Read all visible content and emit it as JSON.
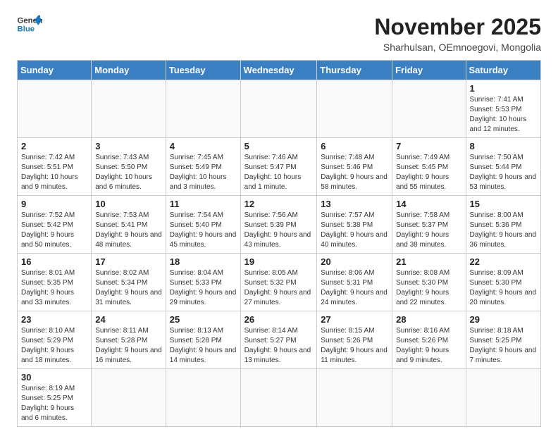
{
  "logo": {
    "text_general": "General",
    "text_blue": "Blue"
  },
  "title": "November 2025",
  "subtitle": "Sharhulsan, OEmnoegovi, Mongolia",
  "days_of_week": [
    "Sunday",
    "Monday",
    "Tuesday",
    "Wednesday",
    "Thursday",
    "Friday",
    "Saturday"
  ],
  "weeks": [
    [
      {
        "day": "",
        "info": ""
      },
      {
        "day": "",
        "info": ""
      },
      {
        "day": "",
        "info": ""
      },
      {
        "day": "",
        "info": ""
      },
      {
        "day": "",
        "info": ""
      },
      {
        "day": "",
        "info": ""
      },
      {
        "day": "1",
        "info": "Sunrise: 7:41 AM\nSunset: 5:53 PM\nDaylight: 10 hours and 12 minutes."
      }
    ],
    [
      {
        "day": "2",
        "info": "Sunrise: 7:42 AM\nSunset: 5:51 PM\nDaylight: 10 hours and 9 minutes."
      },
      {
        "day": "3",
        "info": "Sunrise: 7:43 AM\nSunset: 5:50 PM\nDaylight: 10 hours and 6 minutes."
      },
      {
        "day": "4",
        "info": "Sunrise: 7:45 AM\nSunset: 5:49 PM\nDaylight: 10 hours and 3 minutes."
      },
      {
        "day": "5",
        "info": "Sunrise: 7:46 AM\nSunset: 5:47 PM\nDaylight: 10 hours and 1 minute."
      },
      {
        "day": "6",
        "info": "Sunrise: 7:48 AM\nSunset: 5:46 PM\nDaylight: 9 hours and 58 minutes."
      },
      {
        "day": "7",
        "info": "Sunrise: 7:49 AM\nSunset: 5:45 PM\nDaylight: 9 hours and 55 minutes."
      },
      {
        "day": "8",
        "info": "Sunrise: 7:50 AM\nSunset: 5:44 PM\nDaylight: 9 hours and 53 minutes."
      }
    ],
    [
      {
        "day": "9",
        "info": "Sunrise: 7:52 AM\nSunset: 5:42 PM\nDaylight: 9 hours and 50 minutes."
      },
      {
        "day": "10",
        "info": "Sunrise: 7:53 AM\nSunset: 5:41 PM\nDaylight: 9 hours and 48 minutes."
      },
      {
        "day": "11",
        "info": "Sunrise: 7:54 AM\nSunset: 5:40 PM\nDaylight: 9 hours and 45 minutes."
      },
      {
        "day": "12",
        "info": "Sunrise: 7:56 AM\nSunset: 5:39 PM\nDaylight: 9 hours and 43 minutes."
      },
      {
        "day": "13",
        "info": "Sunrise: 7:57 AM\nSunset: 5:38 PM\nDaylight: 9 hours and 40 minutes."
      },
      {
        "day": "14",
        "info": "Sunrise: 7:58 AM\nSunset: 5:37 PM\nDaylight: 9 hours and 38 minutes."
      },
      {
        "day": "15",
        "info": "Sunrise: 8:00 AM\nSunset: 5:36 PM\nDaylight: 9 hours and 36 minutes."
      }
    ],
    [
      {
        "day": "16",
        "info": "Sunrise: 8:01 AM\nSunset: 5:35 PM\nDaylight: 9 hours and 33 minutes."
      },
      {
        "day": "17",
        "info": "Sunrise: 8:02 AM\nSunset: 5:34 PM\nDaylight: 9 hours and 31 minutes."
      },
      {
        "day": "18",
        "info": "Sunrise: 8:04 AM\nSunset: 5:33 PM\nDaylight: 9 hours and 29 minutes."
      },
      {
        "day": "19",
        "info": "Sunrise: 8:05 AM\nSunset: 5:32 PM\nDaylight: 9 hours and 27 minutes."
      },
      {
        "day": "20",
        "info": "Sunrise: 8:06 AM\nSunset: 5:31 PM\nDaylight: 9 hours and 24 minutes."
      },
      {
        "day": "21",
        "info": "Sunrise: 8:08 AM\nSunset: 5:30 PM\nDaylight: 9 hours and 22 minutes."
      },
      {
        "day": "22",
        "info": "Sunrise: 8:09 AM\nSunset: 5:30 PM\nDaylight: 9 hours and 20 minutes."
      }
    ],
    [
      {
        "day": "23",
        "info": "Sunrise: 8:10 AM\nSunset: 5:29 PM\nDaylight: 9 hours and 18 minutes."
      },
      {
        "day": "24",
        "info": "Sunrise: 8:11 AM\nSunset: 5:28 PM\nDaylight: 9 hours and 16 minutes."
      },
      {
        "day": "25",
        "info": "Sunrise: 8:13 AM\nSunset: 5:28 PM\nDaylight: 9 hours and 14 minutes."
      },
      {
        "day": "26",
        "info": "Sunrise: 8:14 AM\nSunset: 5:27 PM\nDaylight: 9 hours and 13 minutes."
      },
      {
        "day": "27",
        "info": "Sunrise: 8:15 AM\nSunset: 5:26 PM\nDaylight: 9 hours and 11 minutes."
      },
      {
        "day": "28",
        "info": "Sunrise: 8:16 AM\nSunset: 5:26 PM\nDaylight: 9 hours and 9 minutes."
      },
      {
        "day": "29",
        "info": "Sunrise: 8:18 AM\nSunset: 5:25 PM\nDaylight: 9 hours and 7 minutes."
      }
    ],
    [
      {
        "day": "30",
        "info": "Sunrise: 8:19 AM\nSunset: 5:25 PM\nDaylight: 9 hours and 6 minutes."
      },
      {
        "day": "",
        "info": ""
      },
      {
        "day": "",
        "info": ""
      },
      {
        "day": "",
        "info": ""
      },
      {
        "day": "",
        "info": ""
      },
      {
        "day": "",
        "info": ""
      },
      {
        "day": "",
        "info": ""
      }
    ]
  ]
}
